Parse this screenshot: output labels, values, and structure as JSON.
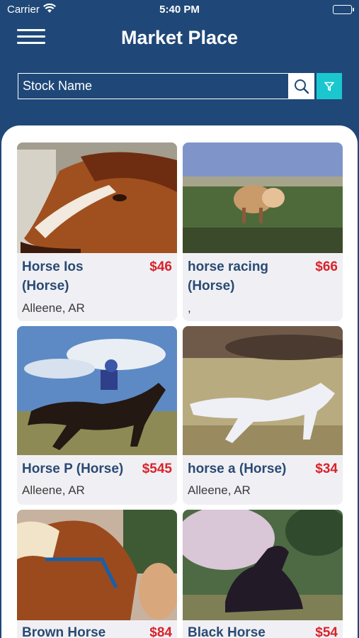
{
  "status": {
    "carrier": "Carrier",
    "time": "5:40 PM"
  },
  "header": {
    "title": "Market Place"
  },
  "search": {
    "placeholder": "Stock Name"
  },
  "cards": [
    {
      "name": "Horse Ios",
      "name2": "(Horse)",
      "price": "$46",
      "location": "Alleene, AR"
    },
    {
      "name": "horse racing",
      "name2": "(Horse)",
      "price": "$66",
      "location": ","
    },
    {
      "name": "Horse P (Horse)",
      "price": "$545",
      "location": "Alleene, AR"
    },
    {
      "name": "horse a (Horse)",
      "price": "$34",
      "location": "Alleene, AR"
    },
    {
      "name": "Brown Horse",
      "price": "$84"
    },
    {
      "name": "Black Horse",
      "price": "$54"
    }
  ],
  "colors": {
    "header_bg": "#1f4878",
    "accent_teal": "#1bc7cf",
    "price_red": "#d8232a",
    "name_blue": "#2a4a73"
  }
}
